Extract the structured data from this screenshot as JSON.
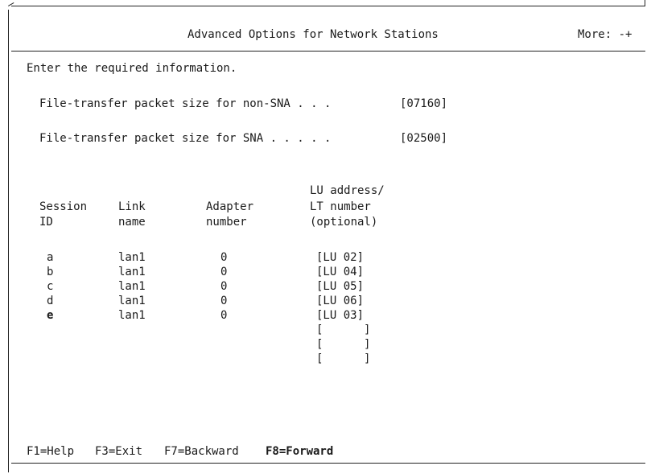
{
  "screen": {
    "title": "Advanced Options for Network Stations",
    "more": "More: -+",
    "instruction": "Enter the required information."
  },
  "fields": {
    "nonsna_label": "File-transfer packet size for non-SNA . . .",
    "nonsna_value": "[07160]",
    "sna_label": "File-transfer packet size for SNA . . . . .",
    "sna_value": "[02500]"
  },
  "table": {
    "headers": {
      "session_1": "Session",
      "session_2": "ID",
      "link_1": "Link",
      "link_2": "name",
      "adapter_1": "Adapter",
      "adapter_2": "number",
      "lu_1": "LU address/",
      "lu_2": "LT number",
      "lu_3": "(optional)"
    },
    "rows": [
      {
        "id": "a",
        "link": "lan1",
        "adapter": "0",
        "lu": "[LU 02]"
      },
      {
        "id": "b",
        "link": "lan1",
        "adapter": "0",
        "lu": "[LU 04]"
      },
      {
        "id": "c",
        "link": "lan1",
        "adapter": "0",
        "lu": "[LU 05]"
      },
      {
        "id": "d",
        "link": "lan1",
        "adapter": "0",
        "lu": "[LU 06]"
      },
      {
        "id": "e",
        "link": "lan1",
        "adapter": "0",
        "lu": "[LU 03]"
      }
    ],
    "empty_lu": [
      "[      ]",
      "[      ]",
      "[      ]"
    ]
  },
  "function_keys": {
    "f1": "F1=Help",
    "f3": "F3=Exit",
    "f7": "F7=Backward",
    "f8": "F8=Forward"
  }
}
